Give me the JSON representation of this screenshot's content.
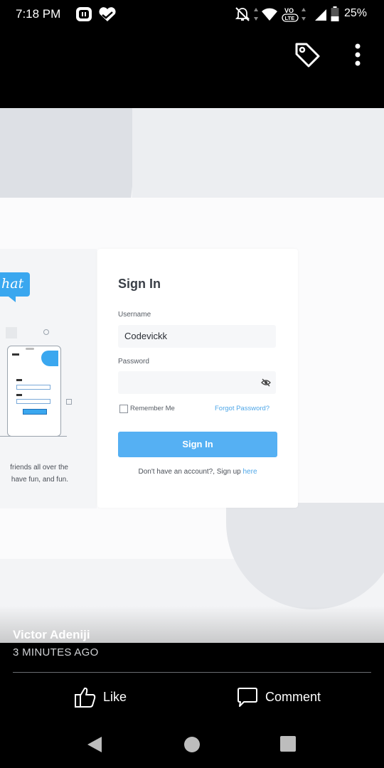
{
  "status_bar": {
    "time": "7:18 PM",
    "battery": "25%",
    "icons": [
      "screen-record-icon",
      "health-heart-icon",
      "notifications-off-icon",
      "wifi-icon",
      "volte-icon",
      "signal-icon",
      "battery-icon"
    ]
  },
  "top_bar": {
    "icons": [
      "tag-icon",
      "more-vert-icon"
    ]
  },
  "photo": {
    "chat_logo_text": "hat",
    "left_caption_lines": [
      "friends all over the",
      "have fun, and fun."
    ],
    "signin_card": {
      "title": "Sign In",
      "username_label": "Username",
      "username_value": "Codevickk",
      "password_label": "Password",
      "password_value": "",
      "remember_label": "Remember Me",
      "forgot_link": "Forgot Password?",
      "button_label": "Sign In",
      "signup_text": "Don't have an account?, Sign up",
      "signup_link": "here"
    }
  },
  "post": {
    "author": "Victor Adeniji",
    "time": "3 MINUTES AGO",
    "like_label": "Like",
    "comment_label": "Comment"
  },
  "nav_bar": {
    "icons": [
      "back-icon",
      "home-icon",
      "recents-icon"
    ]
  },
  "colors": {
    "accent_blue": "#55b0f3",
    "link_blue": "#4fa7e8",
    "background": "#000000"
  }
}
